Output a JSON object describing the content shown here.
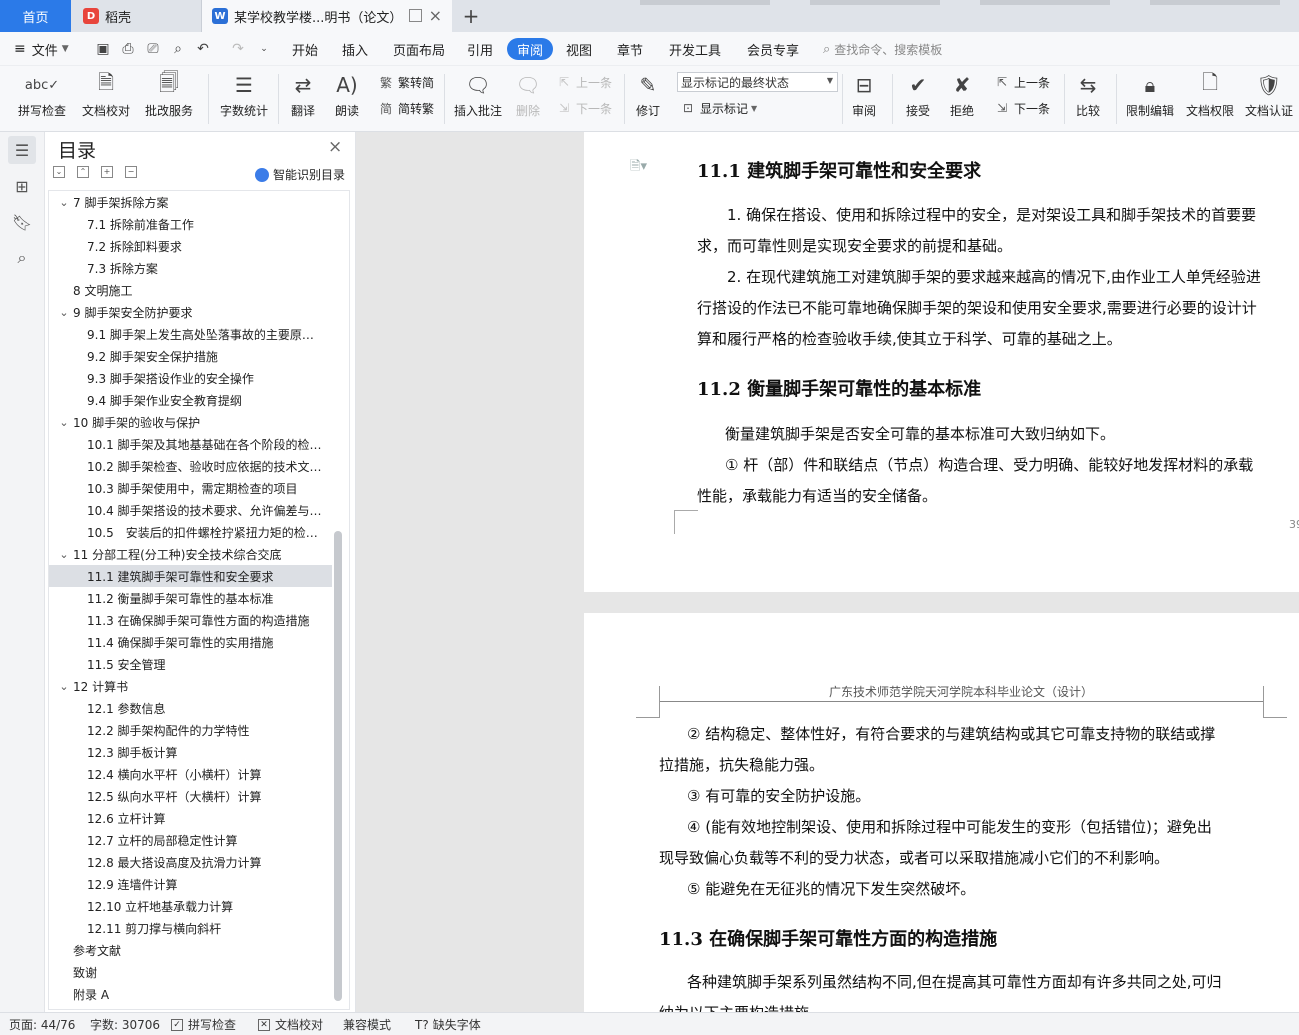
{
  "tabs": {
    "home": "首页",
    "daoke": "稻壳",
    "doc": "某学校教学楼...明书（论文）"
  },
  "menu": {
    "file": "文件",
    "items": [
      "开始",
      "插入",
      "页面布局",
      "引用",
      "审阅",
      "视图",
      "章节",
      "开发工具",
      "会员专享"
    ],
    "active": "审阅",
    "search_placeholder": "查找命令、搜索模板"
  },
  "ribbon": {
    "spellcheck": "拼写检查",
    "doc_proof": "文档校对",
    "annotate_service": "批改服务",
    "word_count": "字数统计",
    "translate": "翻译",
    "read_aloud": "朗读",
    "to_traditional": "繁转简",
    "to_simplified": "简转繁",
    "insert_comment": "插入批注",
    "delete": "删除",
    "prev": "上一条",
    "next": "下一条",
    "revise": "修订",
    "markup_select": "显示标记的最终状态",
    "show_markup": "显示标记",
    "review": "审阅",
    "accept": "接受",
    "reject": "拒绝",
    "prev2": "上一条",
    "next2": "下一条",
    "compare": "比较",
    "restrict_edit": "限制编辑",
    "doc_permission": "文档权限",
    "doc_cert": "文档认证"
  },
  "toc": {
    "title": "目录",
    "smart": "智能识别目录",
    "items": [
      {
        "text": "7 脚手架拆除方案",
        "level": 1,
        "expanded": true
      },
      {
        "text": "7.1 拆除前准备工作",
        "level": 2
      },
      {
        "text": "7.2 拆除卸料要求",
        "level": 2
      },
      {
        "text": "7.3 拆除方案",
        "level": 2
      },
      {
        "text": "8 文明施工",
        "level": 1
      },
      {
        "text": "9 脚手架安全防护要求",
        "level": 1,
        "expanded": true
      },
      {
        "text": "9.1 脚手架上发生高处坠落事故的主要原…",
        "level": 2
      },
      {
        "text": "9.2 脚手架安全保护措施",
        "level": 2
      },
      {
        "text": "9.3 脚手架搭设作业的安全操作",
        "level": 2
      },
      {
        "text": "9.4 脚手架作业安全教育提纲",
        "level": 2
      },
      {
        "text": "10 脚手架的验收与保护",
        "level": 1,
        "expanded": true
      },
      {
        "text": "10.1 脚手架及其地基基础在各个阶段的检…",
        "level": 2
      },
      {
        "text": "10.2 脚手架检查、验收时应依据的技术文…",
        "level": 2
      },
      {
        "text": "10.3 脚手架使用中，需定期检查的项目",
        "level": 2
      },
      {
        "text": "10.4 脚手架搭设的技术要求、允许偏差与…",
        "level": 2
      },
      {
        "text": "10.5　安装后的扣件螺栓拧紧扭力矩的检…",
        "level": 2
      },
      {
        "text": "11 分部工程(分工种)安全技术综合交底",
        "level": 1,
        "expanded": true
      },
      {
        "text": "11.1 建筑脚手架可靠性和安全要求",
        "level": 2,
        "selected": true
      },
      {
        "text": "11.2 衡量脚手架可靠性的基本标准",
        "level": 2
      },
      {
        "text": "11.3 在确保脚手架可靠性方面的构造措施",
        "level": 2
      },
      {
        "text": "11.4 确保脚手架可靠性的实用措施",
        "level": 2
      },
      {
        "text": "11.5 安全管理",
        "level": 2
      },
      {
        "text": "12 计算书",
        "level": 1,
        "expanded": true
      },
      {
        "text": "12.1 参数信息",
        "level": 2
      },
      {
        "text": "12.2 脚手架构配件的力学特性",
        "level": 2
      },
      {
        "text": "12.3 脚手板计算",
        "level": 2
      },
      {
        "text": "12.4 横向水平杆（小横杆）计算",
        "level": 2
      },
      {
        "text": "12.5 纵向水平杆（大横杆）计算",
        "level": 2
      },
      {
        "text": "12.6 立杆计算",
        "level": 2
      },
      {
        "text": "12.7 立杆的局部稳定性计算",
        "level": 2
      },
      {
        "text": "12.8 最大搭设高度及抗滑力计算",
        "level": 2
      },
      {
        "text": "12.9 连墙件计算",
        "level": 2
      },
      {
        "text": "12.10 立杆地基承载力计算",
        "level": 2
      },
      {
        "text": "12.11 剪刀撑与横向斜杆",
        "level": 2
      },
      {
        "text": "参考文献",
        "level": 1
      },
      {
        "text": "致谢",
        "level": 1
      },
      {
        "text": "附录 A",
        "level": 1
      }
    ]
  },
  "doc": {
    "page1": {
      "heading1": "11.1 建筑脚手架可靠性和安全要求",
      "p1a": "1. 确保在搭设、使用和拆除过程中的安全，是对架设工具和脚手架技术的首要要",
      "p1b": "求，而可靠性则是实现安全要求的前提和基础。",
      "p2a": "2. 在现代建筑施工对建筑脚手架的要求越来越高的情况下,由作业工人单凭经验进",
      "p2b": "行搭设的作法已不能可靠地确保脚手架的架设和使用安全要求,需要进行必要的设计计",
      "p2c": "算和履行严格的检查验收手续,使其立于科学、可靠的基础之上。",
      "heading2": "11.2 衡量脚手架可靠性的基本标准",
      "p3": "衡量建筑脚手架是否安全可靠的基本标准可大致归纳如下。",
      "p4a": "① 杆（部）件和联结点（节点）构造合理、受力明确、能较好地发挥材料的承载",
      "p4b": "性能，承载能力有适当的安全储备。",
      "page_num": "39"
    },
    "page2": {
      "header": "广东技术师范学院天河学院本科毕业论文（设计）",
      "p1a": "② 结构稳定、整体性好，有符合要求的与建筑结构或其它可靠支持物的联结或撑",
      "p1b": "拉措施，抗失稳能力强。",
      "p2": "③ 有可靠的安全防护设施。",
      "p3a": "④ (能有效地控制架设、使用和拆除过程中可能发生的变形（包括错位)；避免出",
      "p3b": "现导致偏心负载等不利的受力状态，或者可以采取措施减小它们的不利影响。",
      "p4": "⑤ 能避免在无征兆的情况下发生突然破坏。",
      "heading3": "11.3 在确保脚手架可靠性方面的构造措施",
      "p5a": "各种建筑脚手架系列虽然结构不同,但在提高其可靠性方面却有许多共同之处,可归",
      "p5b": "纳为以下主要构造措施"
    }
  },
  "status": {
    "page": "页面: 44/76",
    "words": "字数: 30706",
    "spell": "拼写检查",
    "proof": "文档校对",
    "compat": "兼容模式",
    "missing_font": "缺失字体"
  },
  "colors": {
    "accent": "#2b7ae8",
    "daoke_red": "#e8453c"
  }
}
